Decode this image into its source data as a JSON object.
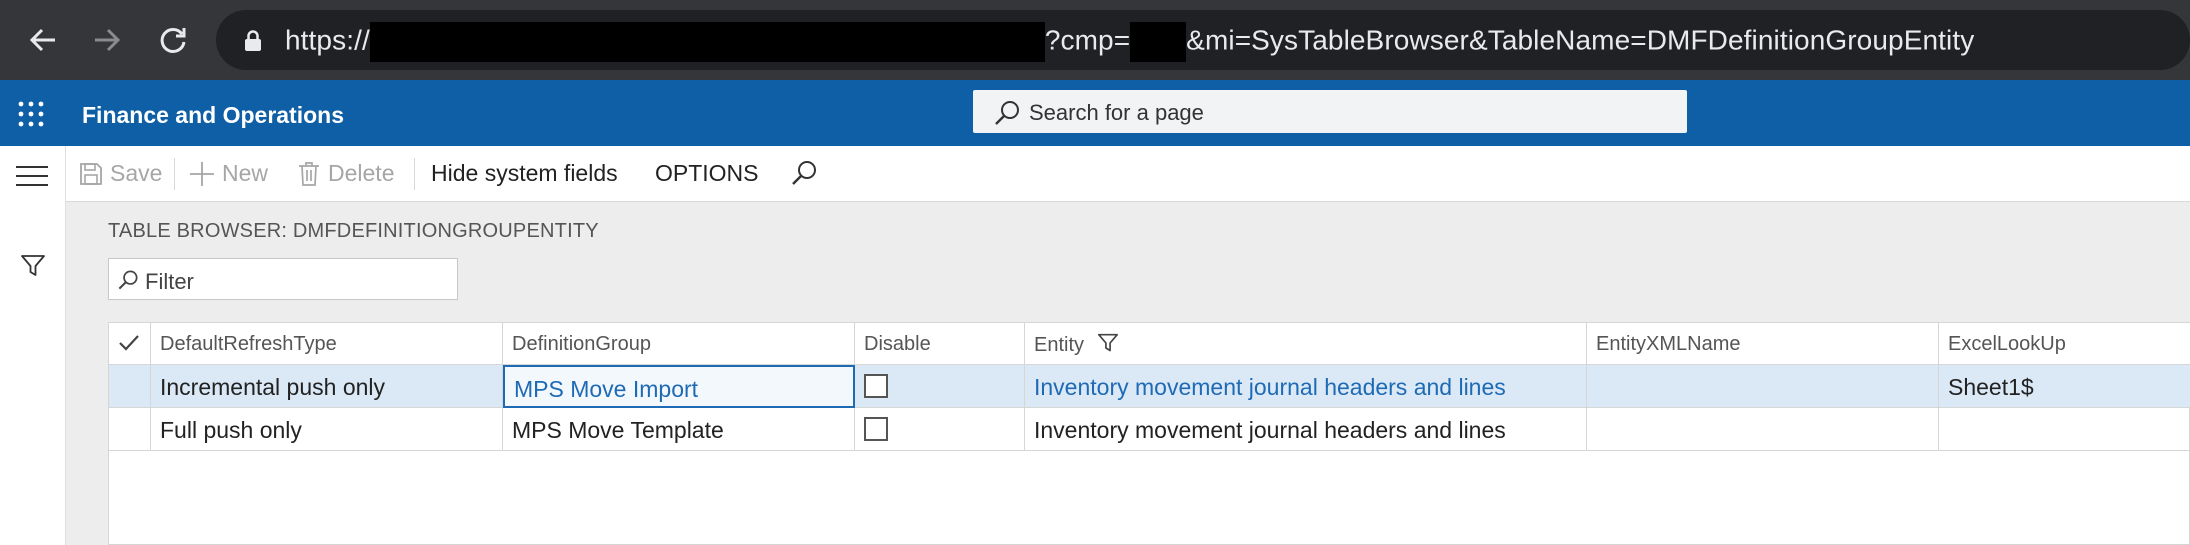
{
  "browser": {
    "url_scheme": "https://",
    "url_mid": "?cmp=",
    "url_tail": "&mi=SysTableBrowser&TableName=DMFDefinitionGroupEntity"
  },
  "appbar": {
    "title": "Finance and Operations",
    "search_placeholder": "Search for a page"
  },
  "actions": {
    "save": "Save",
    "new": "New",
    "delete": "Delete",
    "hide_system_fields": "Hide system fields",
    "options": "OPTIONS"
  },
  "page": {
    "title": "TABLE BROWSER: DMFDEFINITIONGROUPENTITY",
    "filter_placeholder": "Filter"
  },
  "grid": {
    "columns": [
      "DefaultRefreshType",
      "DefinitionGroup",
      "Disable",
      "Entity",
      "EntityXMLName",
      "ExcelLookUp"
    ],
    "rows": [
      {
        "DefaultRefreshType": "Incremental push only",
        "DefinitionGroup": "MPS Move Import",
        "Disable": false,
        "Entity": "Inventory movement journal headers and lines",
        "EntityXMLName": "",
        "ExcelLookUp": "Sheet1$"
      },
      {
        "DefaultRefreshType": "Full push only",
        "DefinitionGroup": "MPS Move Template",
        "Disable": false,
        "Entity": "Inventory movement journal headers and lines",
        "EntityXMLName": "",
        "ExcelLookUp": ""
      }
    ]
  },
  "colors": {
    "browser_bg": "#35363a",
    "url_bg": "#202124",
    "appbar_bg": "#0f5fa7",
    "selected_row": "#dbe9f6",
    "link": "#1e6ab5"
  },
  "icons": [
    "back-arrow-icon",
    "forward-arrow-icon",
    "reload-icon",
    "lock-icon",
    "app-launcher-icon",
    "search-icon",
    "hamburger-menu-icon",
    "filter-funnel-icon",
    "save-icon",
    "plus-icon",
    "trash-icon",
    "checkmark-icon"
  ]
}
